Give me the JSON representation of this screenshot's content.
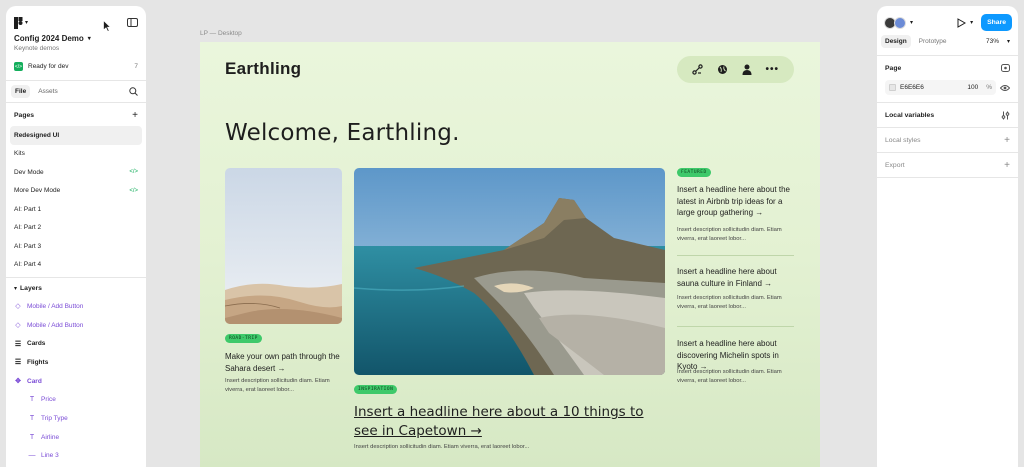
{
  "left": {
    "project_title": "Config 2024 Demo",
    "project_subtitle": "Keynote demos",
    "dev_label": "Ready for dev",
    "dev_count": "7",
    "tabs": [
      "File",
      "Assets"
    ],
    "pages_title": "Pages",
    "pages": [
      "Redesigned UI",
      "Kits",
      "Dev Mode",
      "More Dev Mode",
      "AI: Part 1",
      "AI: Part 2",
      "AI: Part 3",
      "AI: Part 4"
    ],
    "layers_title": "Layers",
    "layers": [
      "Mobile / Add Button",
      "Mobile / Add Button",
      "Cards",
      "Flights",
      "Card",
      "Price",
      "Trip Type",
      "Airline",
      "Line 3"
    ]
  },
  "canvas": {
    "frame_label": "LP — Desktop",
    "brand": "Earthling",
    "welcome": "Welcome, Earthling.",
    "card1": {
      "tag": "ROAD-TRIP",
      "headline": "Make your own path through the Sahara desert →",
      "desc": "Insert description sollicitudin diam. Etiam viverra, erat laoreet lobor..."
    },
    "main": {
      "tag": "INSPIRATION",
      "headline": "Insert a headline here about a 10 things to see in Capetown →",
      "desc": "Insert description sollicitudin diam. Etiam viverra, erat laoreet lobor..."
    },
    "side": [
      {
        "tag": "FEATURED",
        "headline": "Insert a headline here about the latest in Airbnb trip ideas for a large group gathering →",
        "desc": "Insert description sollicitudin diam. Etiam viverra, erat laoreet lobor..."
      },
      {
        "headline": "Insert a headline here about sauna culture in Finland →",
        "desc": "Insert description sollicitudin diam. Etiam viverra, erat laoreet lobor..."
      },
      {
        "headline": "Insert a headline here about discovering Michelin spots in Kyoto →",
        "desc": "Insert description sollicitudin diam. Etiam viverra, erat laoreet lobor..."
      }
    ]
  },
  "right": {
    "share": "Share",
    "tabs": [
      "Design",
      "Prototype"
    ],
    "zoom": "73%",
    "page_title": "Page",
    "color_hex": "E6E6E6",
    "opacity": "100",
    "opacity_unit": "%",
    "local_variables": "Local variables",
    "local_styles": "Local styles",
    "export": "Export"
  },
  "colors": {
    "accent": "#0d99ff",
    "tag_green": "#3ec96a",
    "dev_green": "#14ae5c",
    "layer_purple": "#7a4bd6"
  }
}
